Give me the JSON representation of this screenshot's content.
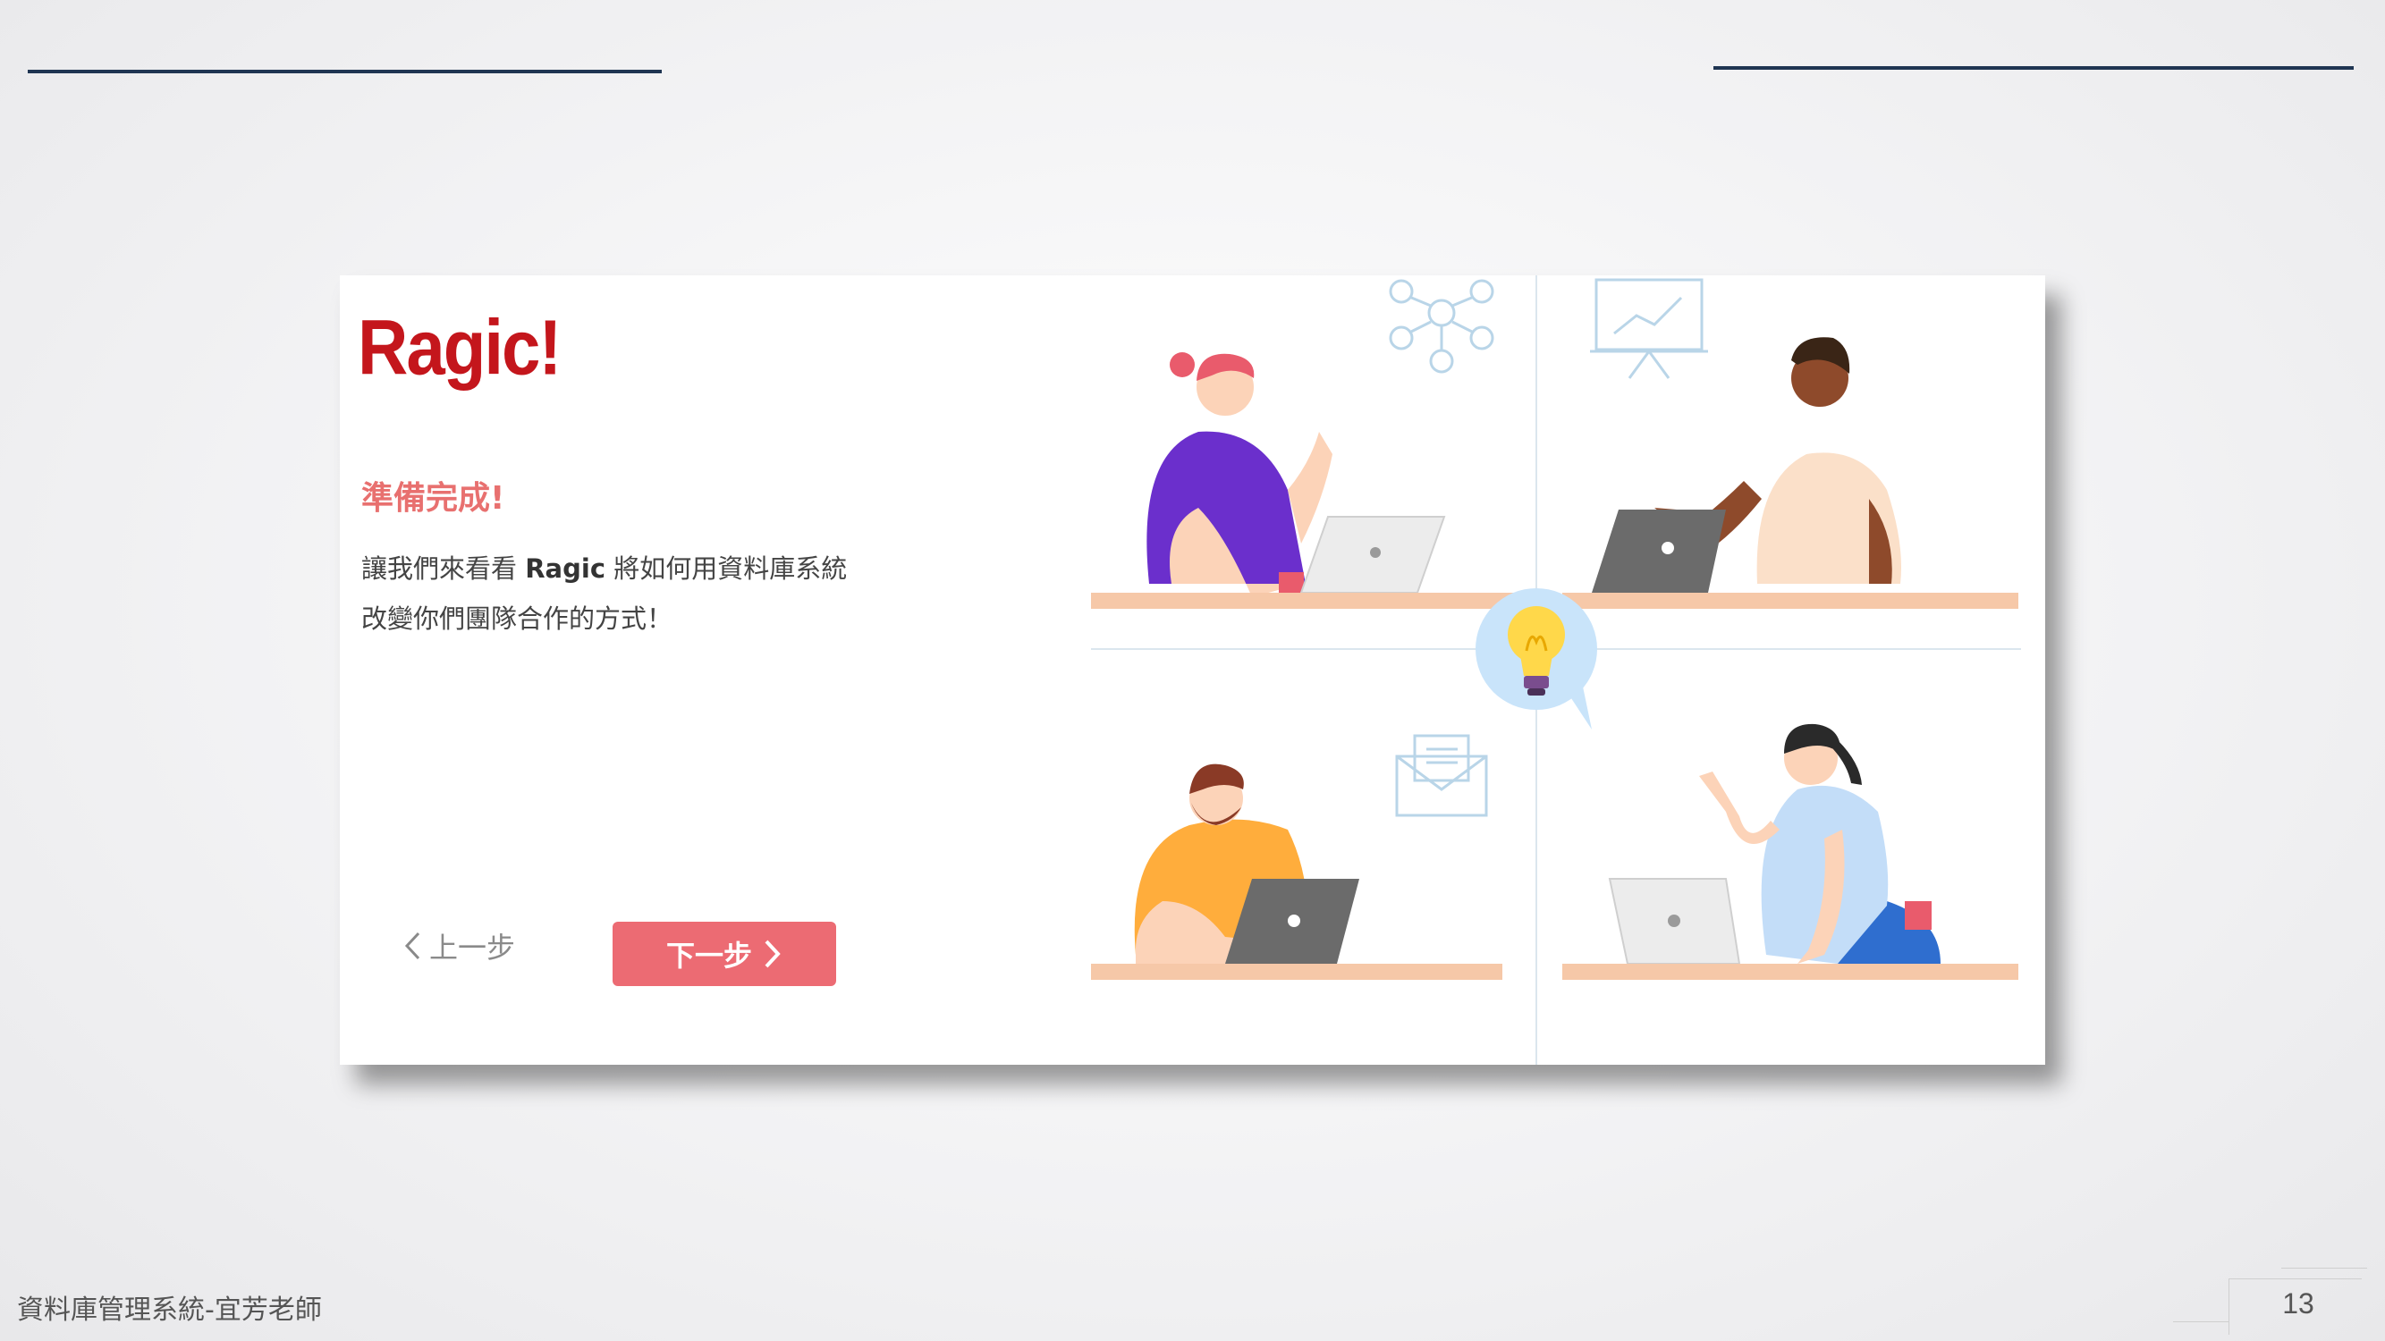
{
  "slide": {
    "footer_label": "資料庫管理系統-宜芳老師",
    "page_number": "13"
  },
  "card": {
    "logo": "Ragic!",
    "heading": "準備完成!",
    "intro_line1_pre": "讓我們來看看 ",
    "intro_brand": "Ragic",
    "intro_line1_post": " 將如何用資料庫系統",
    "intro_line2": "改變你們團隊合作的方式！",
    "prev_label": "上一步",
    "next_label": "下一步",
    "prev_icon": "chevron-left-icon",
    "next_icon": "chevron-right-icon"
  },
  "colors": {
    "brand_red": "#c4161c",
    "accent_pink": "#ec6b73",
    "heading_pink": "#e8706f",
    "rule_navy": "#1f3552"
  }
}
